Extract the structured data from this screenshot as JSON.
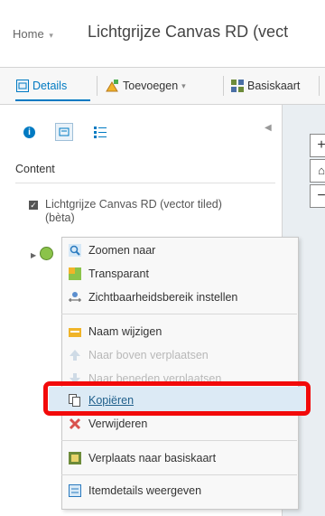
{
  "header": {
    "home_label": "Home",
    "home_chevron": "▾",
    "map_title": "Lichtgrijze Canvas RD (vect"
  },
  "toolbar": {
    "details_label": "Details",
    "add_label": "Toevoegen",
    "add_chevron": "▾",
    "basemap_label": "Basiskaart"
  },
  "panel": {
    "content_label": "Content",
    "layers": [
      {
        "name": "Lichtgrijze Canvas RD (vector tiled) (bèta)",
        "checked": true
      }
    ]
  },
  "map_controls": {
    "zoom_in": "+",
    "zoom_out": "−"
  },
  "context_menu": {
    "items": [
      {
        "label": "Zoomen naar",
        "icon": "zoom-to-icon",
        "enabled": true
      },
      {
        "label": "Transparant",
        "icon": "transparency-icon",
        "enabled": true
      },
      {
        "label": "Zichtbaarheidsbereik instellen",
        "icon": "visibility-range-icon",
        "enabled": true
      },
      {
        "label": "Naam wijzigen",
        "icon": "rename-icon",
        "enabled": true
      },
      {
        "label": "Naar boven verplaatsen",
        "icon": "move-up-icon",
        "enabled": false
      },
      {
        "label": "Naar beneden verplaatsen",
        "icon": "move-down-icon",
        "enabled": false
      },
      {
        "label": "Kopiëren",
        "icon": "copy-icon",
        "enabled": true
      },
      {
        "label": "Verwijderen",
        "icon": "remove-icon",
        "enabled": true
      },
      {
        "label": "Verplaats naar basiskaart",
        "icon": "move-to-basemap-icon",
        "enabled": true
      },
      {
        "label": "Itemdetails weergeven",
        "icon": "item-details-icon",
        "enabled": true
      }
    ]
  },
  "colors": {
    "accent": "#007ac2",
    "highlight": "#f20a0a"
  }
}
